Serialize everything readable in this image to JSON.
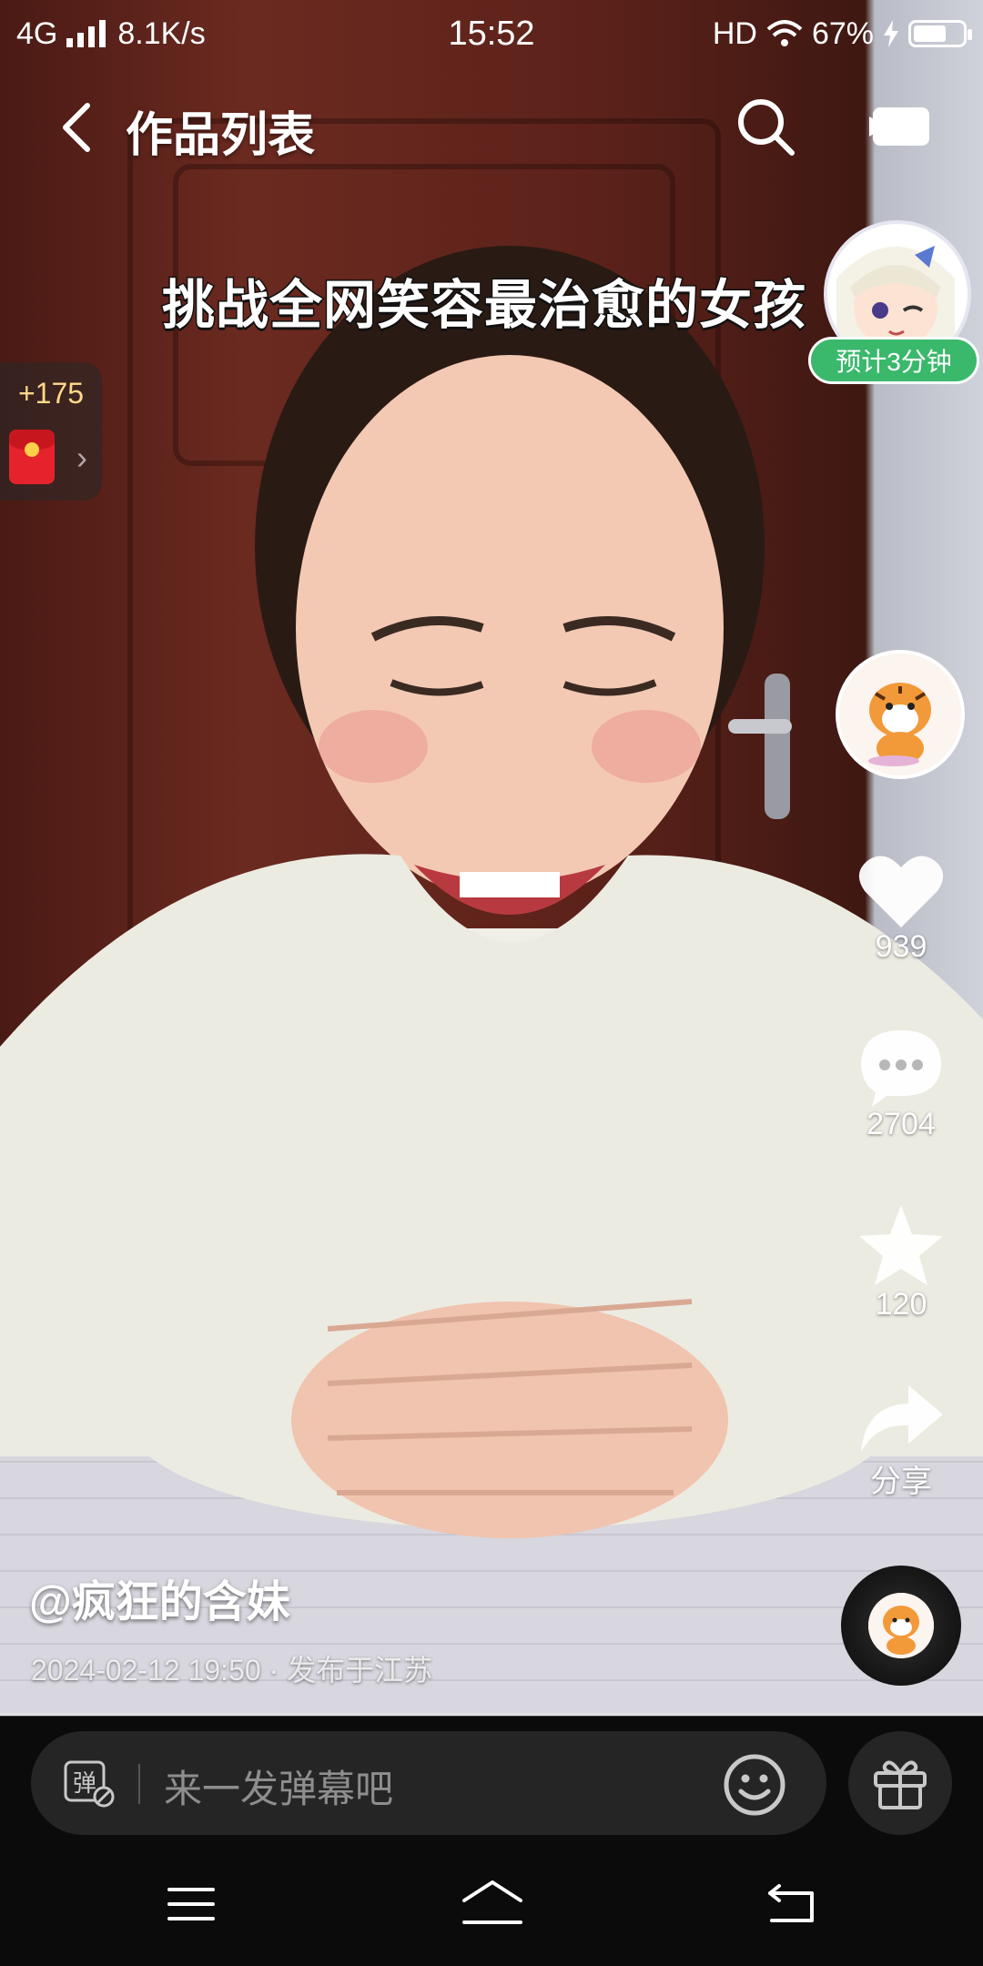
{
  "status_bar": {
    "network": "4G",
    "speed": "8.1K/s",
    "time": "15:52",
    "hd": "HD",
    "battery": "67%",
    "battery_level": 0.67
  },
  "header": {
    "title": "作品列表"
  },
  "video": {
    "caption": "挑战全网笑容最治愈的女孩",
    "timer_label": "预计3分钟",
    "progress": 0.0
  },
  "reward": {
    "points": "+175"
  },
  "actions": {
    "likes": "939",
    "comments": "2704",
    "favorites": "120",
    "share_label": "分享"
  },
  "author": {
    "name": "@疯狂的含妹",
    "meta": "2024-02-12 19:50 · 发布于江苏"
  },
  "danmaku": {
    "placeholder": "来一发弹幕吧",
    "toggle_label": "弹"
  },
  "colors": {
    "timer_green": "#3ab86b",
    "reward_gold": "#ffd98a",
    "red_packet": "#e6232c",
    "panel_bg": "#0b0b0b",
    "input_bg": "#252525"
  }
}
